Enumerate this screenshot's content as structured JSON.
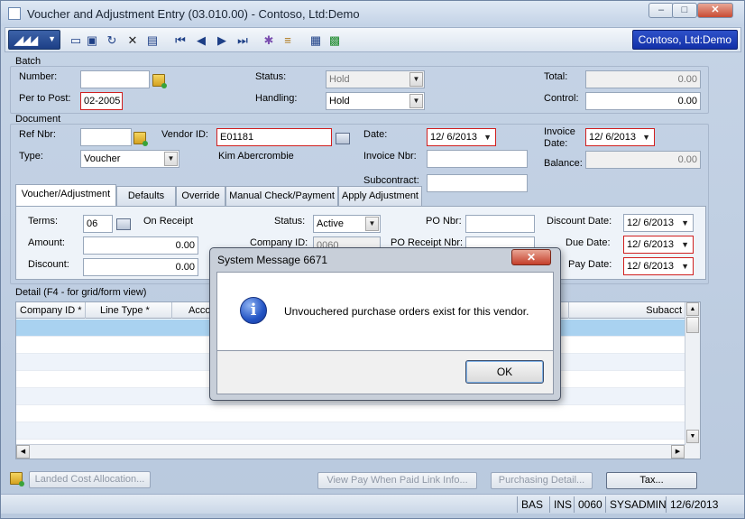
{
  "window": {
    "title": "Voucher and Adjustment Entry (03.010.00) - Contoso, Ltd:Demo"
  },
  "toolbar": {
    "company": "Contoso, Ltd:Demo"
  },
  "batch": {
    "section_label": "Batch",
    "number_label": "Number:",
    "number_value": "",
    "per_to_post_label": "Per to Post:",
    "per_to_post_value": "02-2005",
    "status_label": "Status:",
    "status_value": "Hold",
    "handling_label": "Handling:",
    "handling_value": "Hold",
    "total_label": "Total:",
    "total_value": "0.00",
    "control_label": "Control:",
    "control_value": "0.00"
  },
  "document": {
    "section_label": "Document",
    "ref_nbr_label": "Ref Nbr:",
    "ref_nbr_value": "",
    "vendor_id_label": "Vendor ID:",
    "vendor_id_value": "E01181",
    "vendor_name": "Kim Abercrombie",
    "type_label": "Type:",
    "type_value": "Voucher",
    "date_label": "Date:",
    "date_value": "12/ 6/2013",
    "invoice_nbr_label": "Invoice Nbr:",
    "invoice_nbr_value": "",
    "subcontract_label": "Subcontract:",
    "subcontract_value": "",
    "invoice_date_label_1": "Invoice",
    "invoice_date_label_2": "Date:",
    "invoice_date_value": "12/ 6/2013",
    "balance_label": "Balance:",
    "balance_value": "0.00"
  },
  "tabs": [
    {
      "label": "Voucher/Adjustment"
    },
    {
      "label": "Defaults"
    },
    {
      "label": "Override"
    },
    {
      "label": "Manual Check/Payment"
    },
    {
      "label": "Apply Adjustment"
    }
  ],
  "voucher_tab": {
    "terms_label": "Terms:",
    "terms_value": "06",
    "terms_desc": "On Receipt",
    "amount_label": "Amount:",
    "amount_value": "0.00",
    "discount_label": "Discount:",
    "discount_value": "0.00",
    "status_label": "Status:",
    "status_value": "Active",
    "company_id_label": "Company ID:",
    "company_id_value": "0060",
    "po_nbr_label": "PO Nbr:",
    "po_nbr_value": "",
    "po_receipt_nbr_label": "PO Receipt Nbr:",
    "discount_date_label": "Discount Date:",
    "discount_date_value": "12/ 6/2013",
    "due_date_label": "Due Date:",
    "due_date_value": "12/ 6/2013",
    "pay_date_label": "Pay Date:",
    "pay_date_value": "12/ 6/2013"
  },
  "detail": {
    "section_label": "Detail  (F4 - for grid/form view)",
    "columns": [
      "Company ID *",
      "Line Type *",
      "Acco",
      "Subacct"
    ]
  },
  "buttons": {
    "landed_cost": "Landed Cost Allocation...",
    "view_pay": "View Pay When Paid Link Info...",
    "purchasing_detail": "Purchasing Detail...",
    "tax": "Tax..."
  },
  "statusbar": {
    "s1": "BAS",
    "s2": "INS",
    "s3": "0060",
    "s4": "SYSADMIN",
    "s5": "12/6/2013"
  },
  "dialog": {
    "title": "System Message 6671",
    "message": "Unvouchered purchase orders exist for this vendor.",
    "ok": "OK"
  }
}
